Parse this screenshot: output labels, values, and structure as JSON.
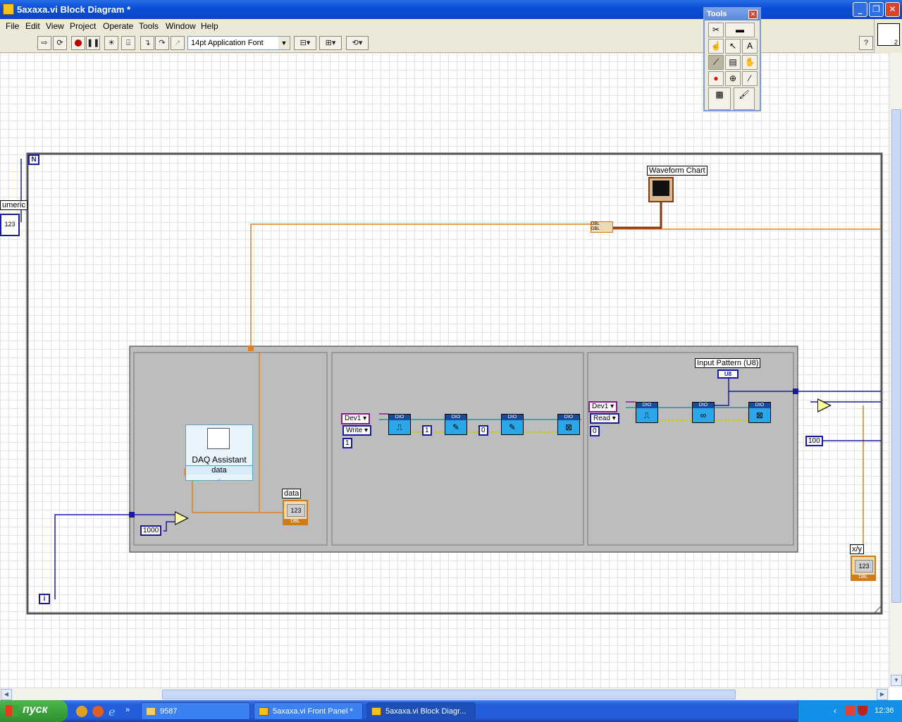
{
  "window": {
    "title": "5axaxa.vi Block Diagram *",
    "minimize": "_",
    "maximize": "❐",
    "close": "✕"
  },
  "menu": [
    "File",
    "Edit",
    "View",
    "Project",
    "Operate",
    "Tools",
    "Window",
    "Help"
  ],
  "toolbar": {
    "font": "14pt Application Font",
    "help": "?"
  },
  "vi_panel": {
    "count": "2"
  },
  "tools_palette": {
    "title": "Tools",
    "close": "✕"
  },
  "diagram": {
    "for_loop_count": "N",
    "loop_iteration": "i",
    "numeric_label": "umeric",
    "numeric_value": "123",
    "waveform_chart_label": "Waveform Chart",
    "bundle_top": "DBL",
    "bundle_bottom": "DBL",
    "daq_assistant": {
      "title": "DAQ Assistant",
      "output": "data"
    },
    "const_1000": "1000",
    "data_label": "data",
    "data_indicator": "123",
    "data_type": "DBL",
    "frame2": {
      "device": "Dev1",
      "mode": "Write",
      "const_1": "1",
      "value_1": "1",
      "value_0": "0"
    },
    "frame3": {
      "device": "Dev1",
      "mode": "Read",
      "const_0": "0",
      "input_label": "Input Pattern (U8)",
      "input_type": "U8"
    },
    "dio_label": "DIO",
    "const_100": "100",
    "xy_label": "x/y",
    "xy_indicator": "123",
    "xy_type": "DBL"
  },
  "taskbar": {
    "start": "пуск",
    "tasks": [
      "9587",
      "5axaxa.vi Front Panel *",
      "5axaxa.vi Block Diagr..."
    ],
    "lang": "EN",
    "clock": "12:36"
  }
}
